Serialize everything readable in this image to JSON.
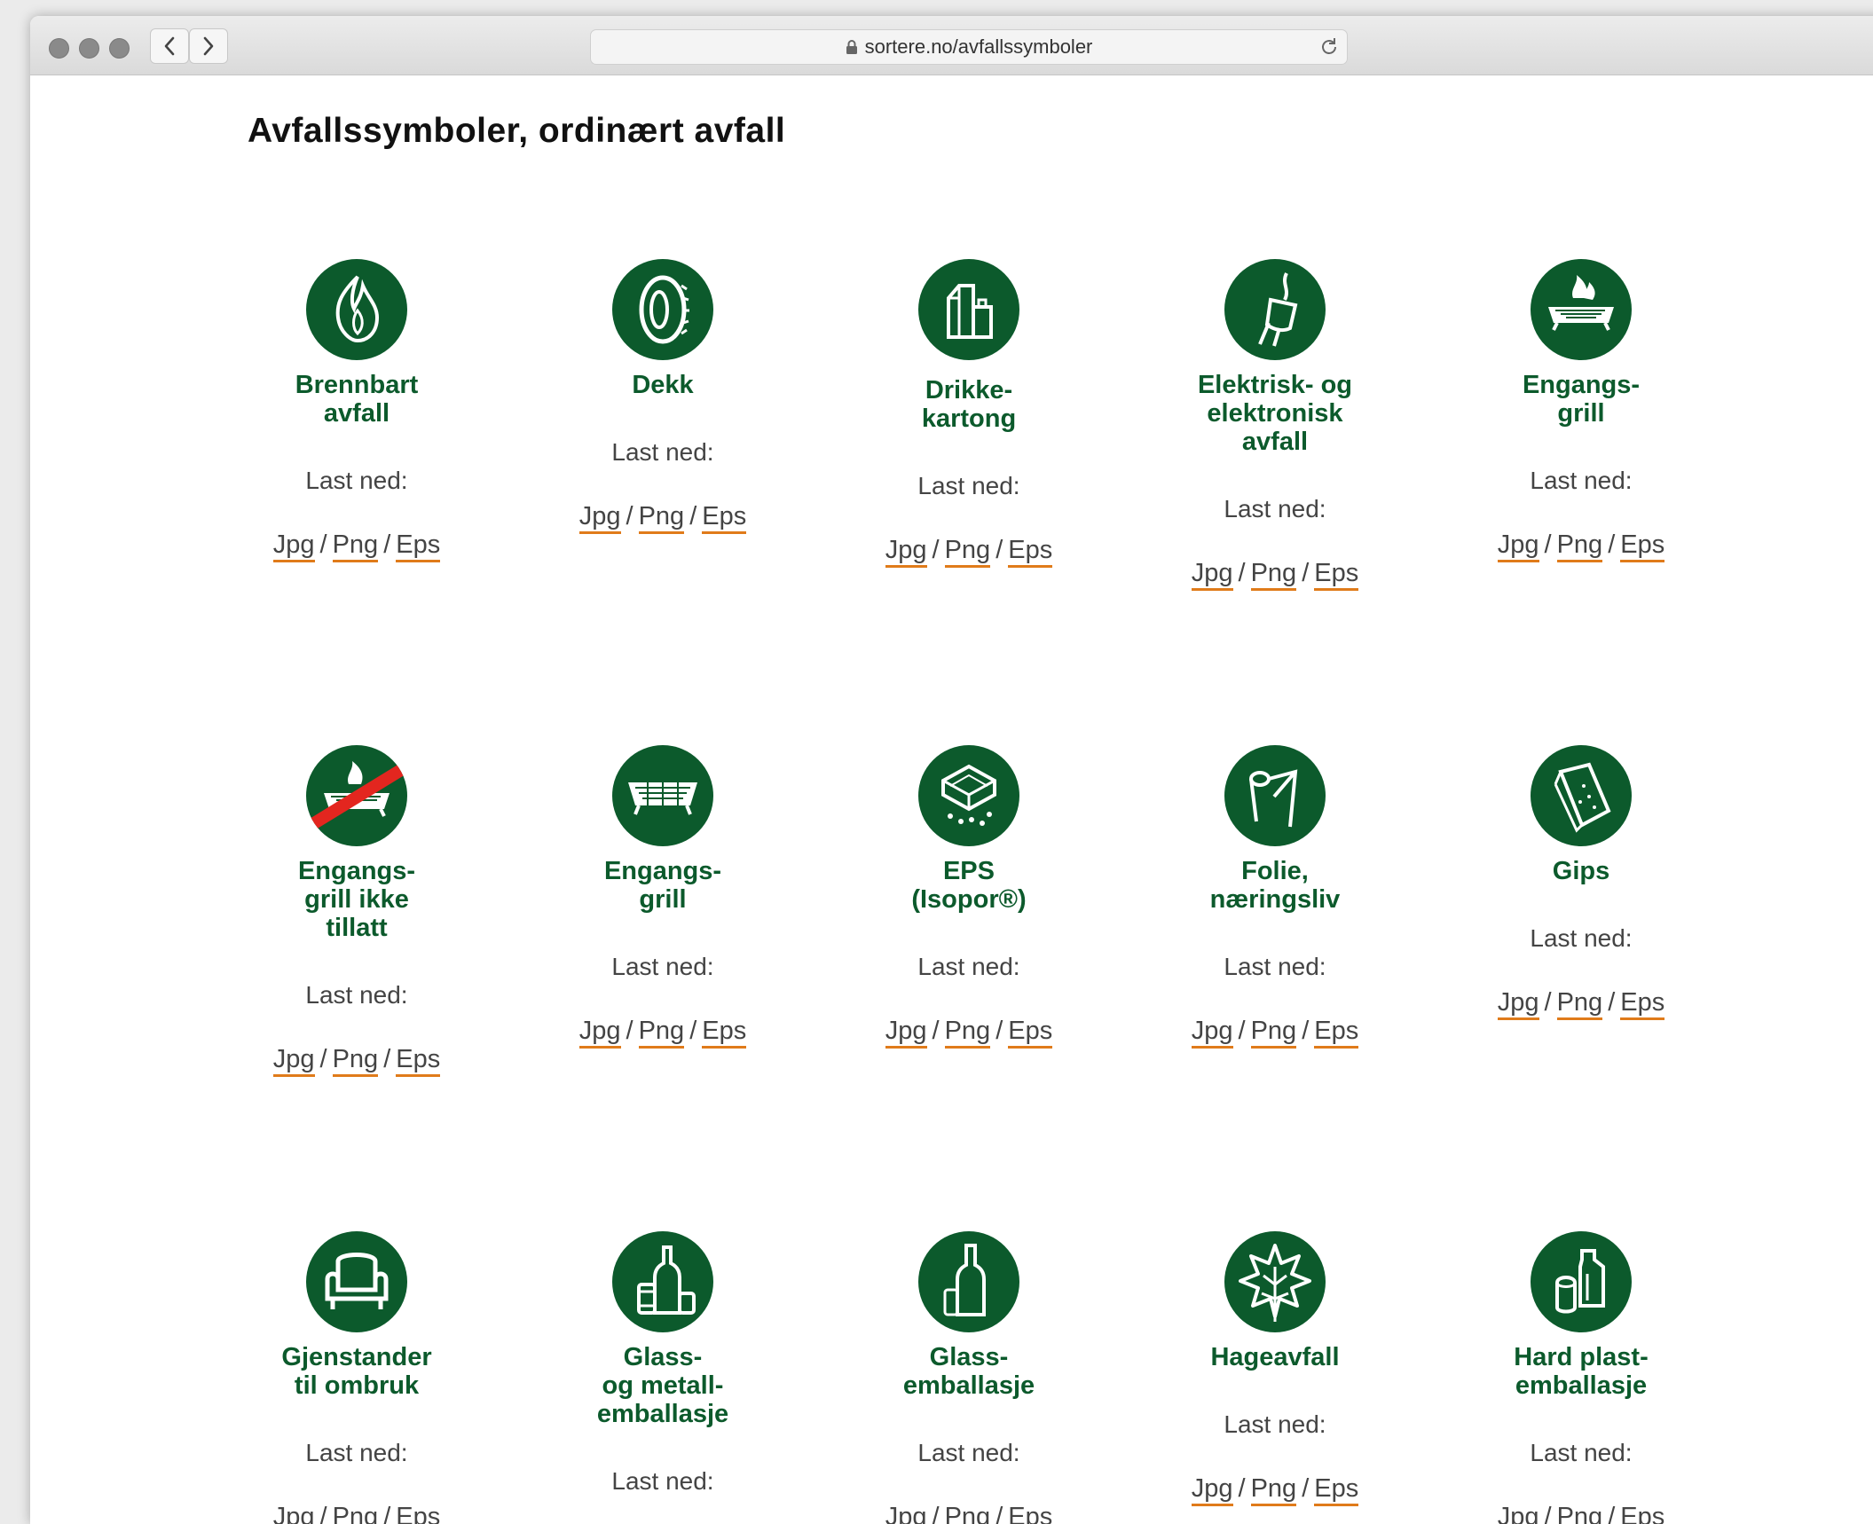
{
  "browser": {
    "url": "sortere.no/avfallssymboler"
  },
  "page": {
    "heading": "Avfallssymboler, ordinært avfall",
    "download_label": "Last ned:",
    "link_labels": {
      "jpg": "Jpg",
      "png": "Png",
      "eps": "Eps",
      "separator": "/"
    }
  },
  "colors": {
    "icon_green": "#0c5a2c",
    "link_underline": "#e07b1a",
    "forbidden_stripe": "#e3261f"
  },
  "symbols": [
    {
      "label": "Brennbart\navfall",
      "icon": "flame-icon"
    },
    {
      "label": "Dekk",
      "icon": "tire-icon"
    },
    {
      "label": "Drikke-\nkartong",
      "icon": "beverage-carton-icon"
    },
    {
      "label": "Elektrisk- og\nelektronisk\navfall",
      "icon": "electric-plug-icon"
    },
    {
      "label": "Engangs-\ngrill",
      "icon": "disposable-grill-icon"
    },
    {
      "label": "Engangs-\ngrill ikke\ntillatt",
      "icon": "grill-not-allowed-icon"
    },
    {
      "label": "Engangs-\ngrill",
      "icon": "grill-icon"
    },
    {
      "label": "EPS\n(Isopor®)",
      "icon": "eps-styrofoam-icon"
    },
    {
      "label": "Folie,\nnæringsliv",
      "icon": "plastic-film-icon"
    },
    {
      "label": "Gips",
      "icon": "plasterboard-icon"
    },
    {
      "label": "Gjenstander\ntil ombruk",
      "icon": "armchair-icon"
    },
    {
      "label": "Glass-\nog metall-\nemballasje",
      "icon": "glass-metal-packaging-icon"
    },
    {
      "label": "Glass-\nemballasje",
      "icon": "glass-bottle-icon"
    },
    {
      "label": "Hageavfall",
      "icon": "leaf-icon"
    },
    {
      "label": "Hard plast-\nemballasje",
      "icon": "hard-plastic-packaging-icon"
    }
  ]
}
